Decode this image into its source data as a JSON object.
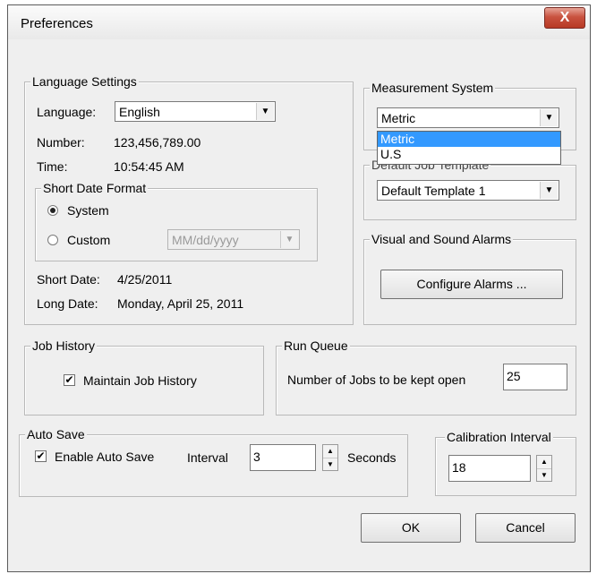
{
  "window": {
    "title": "Preferences",
    "close_glyph": "X"
  },
  "language_settings": {
    "group_label": "Language Settings",
    "language_label": "Language:",
    "language_value": "English",
    "number_label": "Number:",
    "number_value": "123,456,789.00",
    "time_label": "Time:",
    "time_value": "10:54:45 AM",
    "short_date_format": {
      "group_label": "Short Date Format",
      "system_label": "System",
      "system_selected": true,
      "custom_label": "Custom",
      "custom_selected": false,
      "custom_format_value": "MM/dd/yyyy"
    },
    "short_date_label": "Short Date:",
    "short_date_value": "4/25/2011",
    "long_date_label": "Long Date:",
    "long_date_value": "Monday, April 25, 2011"
  },
  "measurement_system": {
    "group_label": "Measurement System",
    "value": "Metric",
    "dropdown_open": true,
    "options": [
      "Metric",
      "U.S"
    ],
    "highlighted_option": "Metric"
  },
  "default_job_template": {
    "group_label_visible_fragment": "Default Job Template",
    "value": "Default Template 1"
  },
  "alarms": {
    "group_label": "Visual and Sound Alarms",
    "configure_button": "Configure Alarms ..."
  },
  "job_history": {
    "group_label": "Job History",
    "maintain_label": "Maintain Job History",
    "maintain_checked": true
  },
  "run_queue": {
    "group_label": "Run Queue",
    "jobs_open_label": "Number of Jobs to be kept open",
    "jobs_open_value": "25"
  },
  "auto_save": {
    "group_label": "Auto Save",
    "enable_label": "Enable Auto Save",
    "enable_checked": true,
    "interval_label": "Interval",
    "interval_value": "3",
    "seconds_label": "Seconds"
  },
  "calibration": {
    "group_label": "Calibration Interval",
    "value": "18"
  },
  "buttons": {
    "ok": "OK",
    "cancel": "Cancel"
  },
  "icons": {
    "check": "✔",
    "arrow_down": "▼",
    "arrow_up": "▲"
  }
}
